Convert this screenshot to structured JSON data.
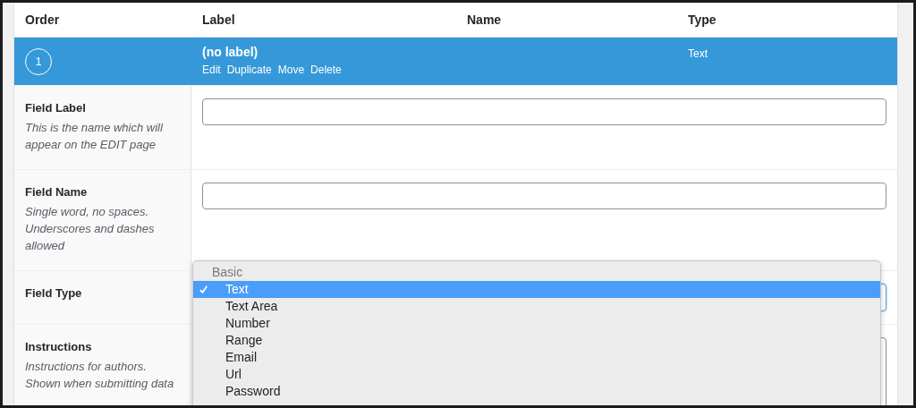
{
  "columns": [
    "Order",
    "Label",
    "Name",
    "Type"
  ],
  "field": {
    "order": "1",
    "label": "(no label)",
    "actions": [
      "Edit",
      "Duplicate",
      "Move",
      "Delete"
    ],
    "type": "Text"
  },
  "settings": [
    {
      "kind": "input",
      "label": "Field Label",
      "description": "This is the name which will appear on the EDIT page"
    },
    {
      "kind": "input",
      "label": "Field Name",
      "description": "Single word, no spaces. Underscores and dashes allowed"
    },
    {
      "kind": "select",
      "label": "Field Type"
    },
    {
      "kind": "textarea",
      "label": "Instructions",
      "description": "Instructions for authors. Shown when submitting data"
    }
  ],
  "dropdown": {
    "groups": [
      {
        "label": "Basic",
        "options": [
          {
            "label": "Text",
            "selected": true
          },
          {
            "label": "Text Area",
            "selected": false
          },
          {
            "label": "Number",
            "selected": false
          },
          {
            "label": "Range",
            "selected": false
          },
          {
            "label": "Email",
            "selected": false
          },
          {
            "label": "Url",
            "selected": false
          },
          {
            "label": "Password",
            "selected": false
          }
        ]
      }
    ]
  }
}
